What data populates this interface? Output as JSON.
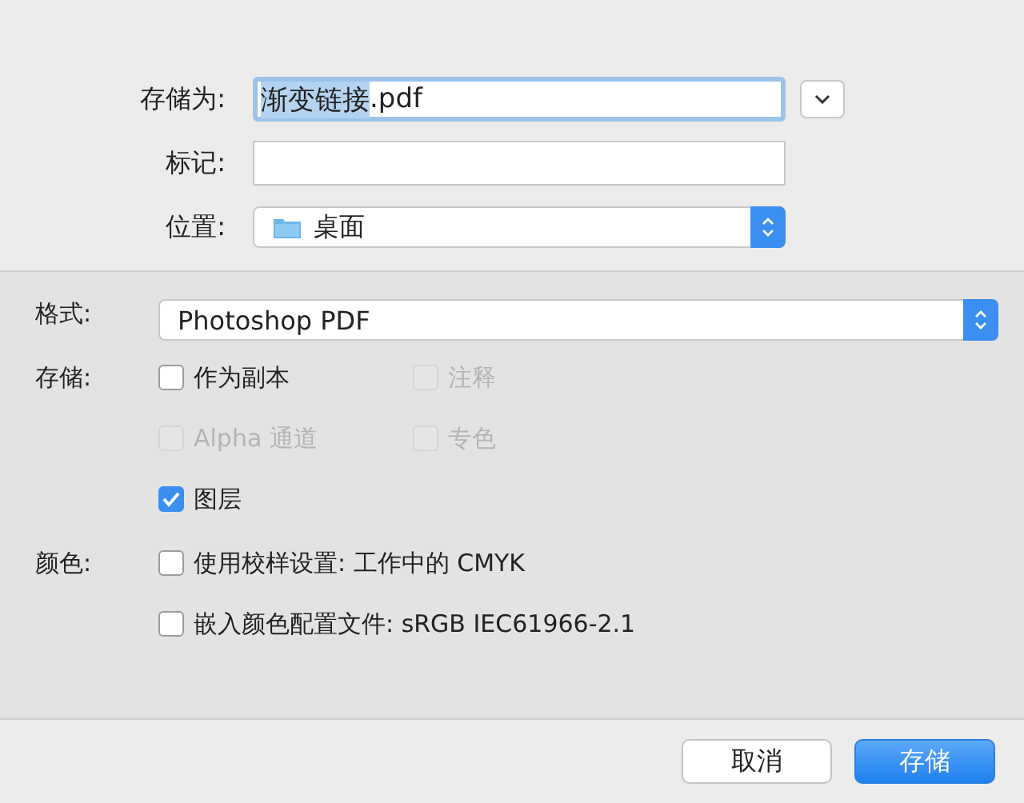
{
  "top": {
    "save_as": {
      "label": "存储为:",
      "selected_part": "渐变链接",
      "rest": ".pdf",
      "focused": true
    },
    "tags": {
      "label": "标记:"
    },
    "location": {
      "label": "位置:",
      "value": "桌面"
    }
  },
  "format": {
    "label": "格式:",
    "value": "Photoshop PDF"
  },
  "save_options": {
    "label": "存储:",
    "items": [
      {
        "label": "作为副本",
        "checked": false,
        "disabled": false
      },
      {
        "label": "注释",
        "checked": false,
        "disabled": true
      },
      {
        "label": "Alpha 通道",
        "checked": false,
        "disabled": true
      },
      {
        "label": "专色",
        "checked": false,
        "disabled": true
      },
      {
        "label": "图层",
        "checked": true,
        "disabled": false
      }
    ]
  },
  "color_options": {
    "label": "颜色:",
    "items": [
      {
        "label": "使用校样设置: 工作中的 CMYK",
        "checked": false,
        "disabled": false
      },
      {
        "label": "嵌入颜色配置文件: sRGB IEC61966-2.1",
        "checked": false,
        "disabled": false
      }
    ]
  },
  "buttons": [
    {
      "label": "取消",
      "kind": "secondary"
    },
    {
      "label": "存储",
      "kind": "primary"
    }
  ]
}
